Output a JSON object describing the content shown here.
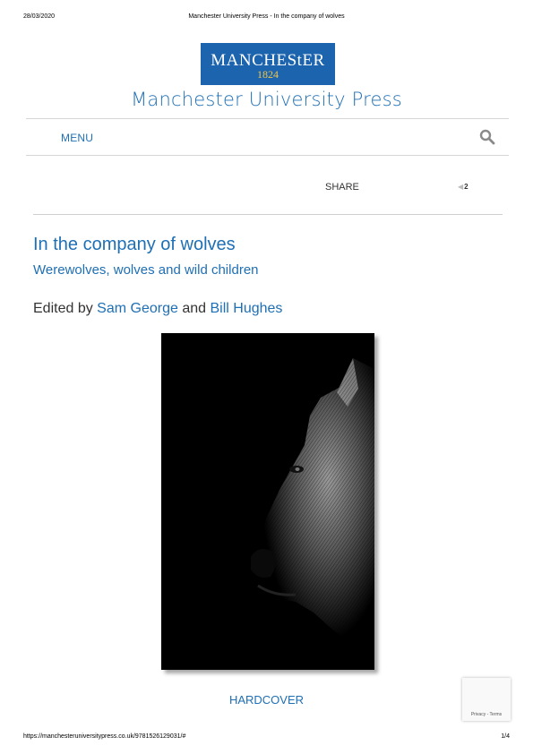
{
  "print_header": {
    "date": "28/03/2020",
    "page_title": "Manchester University Press - In the company of wolves"
  },
  "logo": {
    "word": "MANCHEStER",
    "year": "1824"
  },
  "site": {
    "name": "Manchester University Press"
  },
  "nav": {
    "menu_label": "MENU",
    "search_icon": "search-icon"
  },
  "share": {
    "label": "SHARE",
    "count": "2"
  },
  "book": {
    "title": "In the company of wolves",
    "subtitle": "Werewolves, wolves and wild children",
    "edited_prefix": "Edited by",
    "editor_1": "Sam George",
    "conjunction": "and",
    "editor_2": "Bill Hughes",
    "format": "HARDCOVER"
  },
  "recaptcha": {
    "text": "Privacy - Terms"
  },
  "print_footer": {
    "url": "https://manchesteruniversitypress.co.uk/9781526129031/#",
    "page": "1/4"
  },
  "colors": {
    "brand_blue": "#1e6fb4",
    "logo_blue": "#1d64ae",
    "logo_gold": "#f0c54a"
  }
}
